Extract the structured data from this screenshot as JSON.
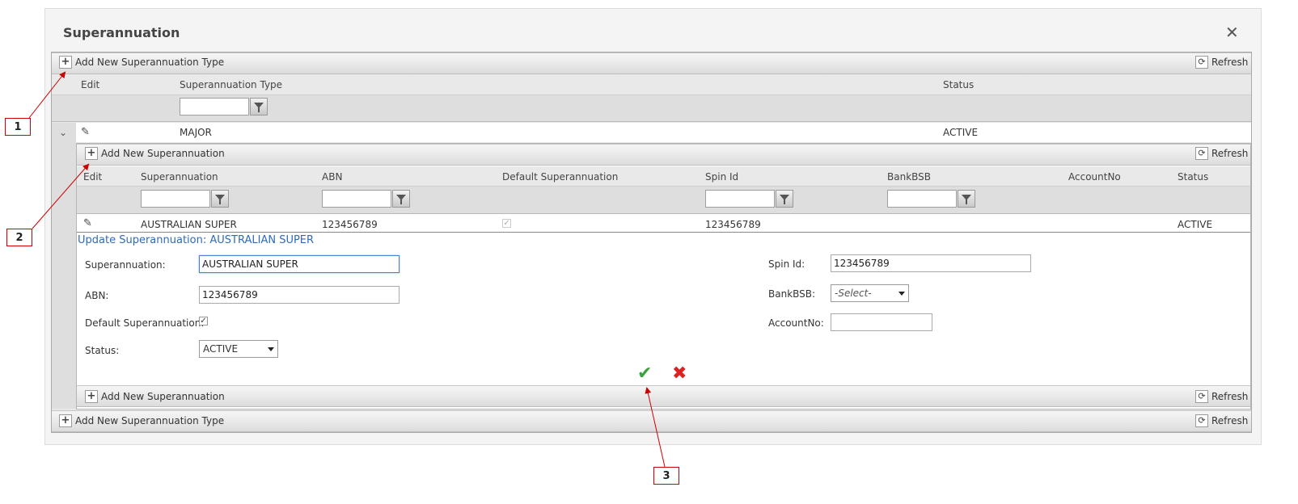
{
  "dialog": {
    "title": "Superannuation"
  },
  "outer_grid": {
    "add_label": "Add New Superannuation Type",
    "refresh_label": "Refresh",
    "columns": [
      "Edit",
      "Superannuation Type",
      "Status"
    ],
    "row": {
      "type": "MAJOR",
      "status": "ACTIVE"
    }
  },
  "inner_grid": {
    "add_label": "Add New Superannuation",
    "refresh_label": "Refresh",
    "columns": [
      "Edit",
      "Superannuation",
      "ABN",
      "Default Superannuation",
      "Spin Id",
      "BankBSB",
      "AccountNo",
      "Status"
    ],
    "row": {
      "superannuation": "AUSTRALIAN SUPER",
      "abn": "123456789",
      "default": true,
      "spin_id": "123456789",
      "status": "ACTIVE"
    }
  },
  "form": {
    "title": "Update Superannuation: AUSTRALIAN SUPER",
    "superannuation_label": "Superannuation:",
    "superannuation_value": "AUSTRALIAN SUPER",
    "abn_label": "ABN:",
    "abn_value": "123456789",
    "default_label": "Default Superannuation:",
    "status_label": "Status:",
    "status_value": "ACTIVE",
    "spin_label": "Spin Id:",
    "spin_value": "123456789",
    "bankbsb_label": "BankBSB:",
    "bankbsb_placeholder": "-Select-",
    "account_label": "AccountNo:",
    "account_value": ""
  },
  "callouts": [
    "1",
    "2",
    "3"
  ],
  "colors": {
    "title_blue": "#2e6bb8",
    "callout_red": "#cc0000",
    "save_green": "#3aa33a",
    "cancel_red": "#dd2222"
  },
  "icons": {
    "close": "close-icon",
    "plus": "plus-icon",
    "refresh": "refresh-icon",
    "filter": "filter-icon",
    "edit": "pencil-icon",
    "expand": "chevron-down-icon",
    "save": "checkmark-icon",
    "cancel": "cross-icon"
  }
}
